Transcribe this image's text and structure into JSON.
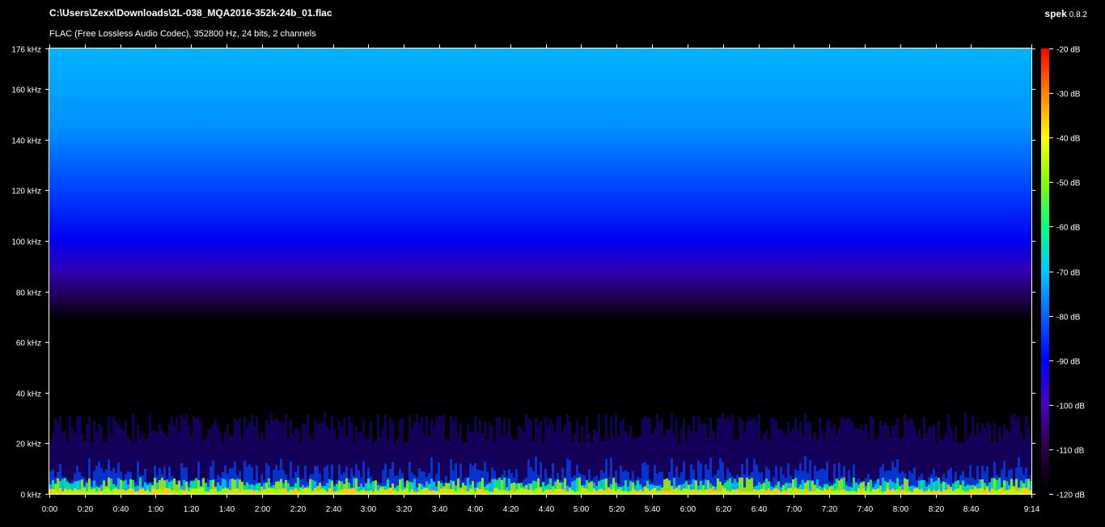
{
  "window": {
    "file_path": "C:\\Users\\Zexx\\Downloads\\2L-038_MQA2016-352k-24b_01.flac",
    "codec_info": "FLAC (Free Lossless Audio Codec), 352800 Hz, 24 bits, 2 channels",
    "app_name": "spek",
    "app_version": "0.8.2"
  },
  "chart_data": {
    "type": "heatmap",
    "duration_s": 554,
    "x_ticks": [
      "0:00",
      "0:20",
      "0:40",
      "1:00",
      "1:20",
      "1:40",
      "2:00",
      "2:20",
      "2:40",
      "3:00",
      "3:20",
      "3:40",
      "4:00",
      "4:20",
      "4:40",
      "5:00",
      "5:20",
      "5:40",
      "6:00",
      "6:20",
      "6:40",
      "7:00",
      "7:20",
      "7:40",
      "8:00",
      "8:20",
      "8:40",
      "9:14"
    ],
    "x_tick_seconds": [
      0,
      20,
      40,
      60,
      80,
      100,
      120,
      140,
      160,
      180,
      200,
      220,
      240,
      260,
      280,
      300,
      320,
      340,
      360,
      380,
      400,
      420,
      440,
      460,
      480,
      500,
      520,
      554
    ],
    "y_ticks": [
      "0 kHz",
      "20 kHz",
      "40 kHz",
      "60 kHz",
      "80 kHz",
      "100 kHz",
      "120 kHz",
      "140 kHz",
      "160 kHz",
      "176 kHz"
    ],
    "y_tick_khz": [
      0,
      20,
      40,
      60,
      80,
      100,
      120,
      140,
      160,
      176
    ],
    "ylim_khz": [
      0,
      176
    ],
    "colorbar_ticks": [
      "-20 dB",
      "-30 dB",
      "-40 dB",
      "-50 dB",
      "-60 dB",
      "-70 dB",
      "-80 dB",
      "-90 dB",
      "-100 dB",
      "-110 dB",
      "-120 dB"
    ],
    "colorbar_db": [
      -20,
      -30,
      -40,
      -50,
      -60,
      -70,
      -80,
      -90,
      -100,
      -110,
      -120
    ],
    "colorbar_range_db": [
      -120,
      -20
    ],
    "colormap": [
      "#000000",
      "#2a0040",
      "#4b00c0",
      "#0000ff",
      "#0064ff",
      "#00c8ff",
      "#00ff80",
      "#80ff00",
      "#ffff00",
      "#ff8000",
      "#ff0000"
    ]
  }
}
